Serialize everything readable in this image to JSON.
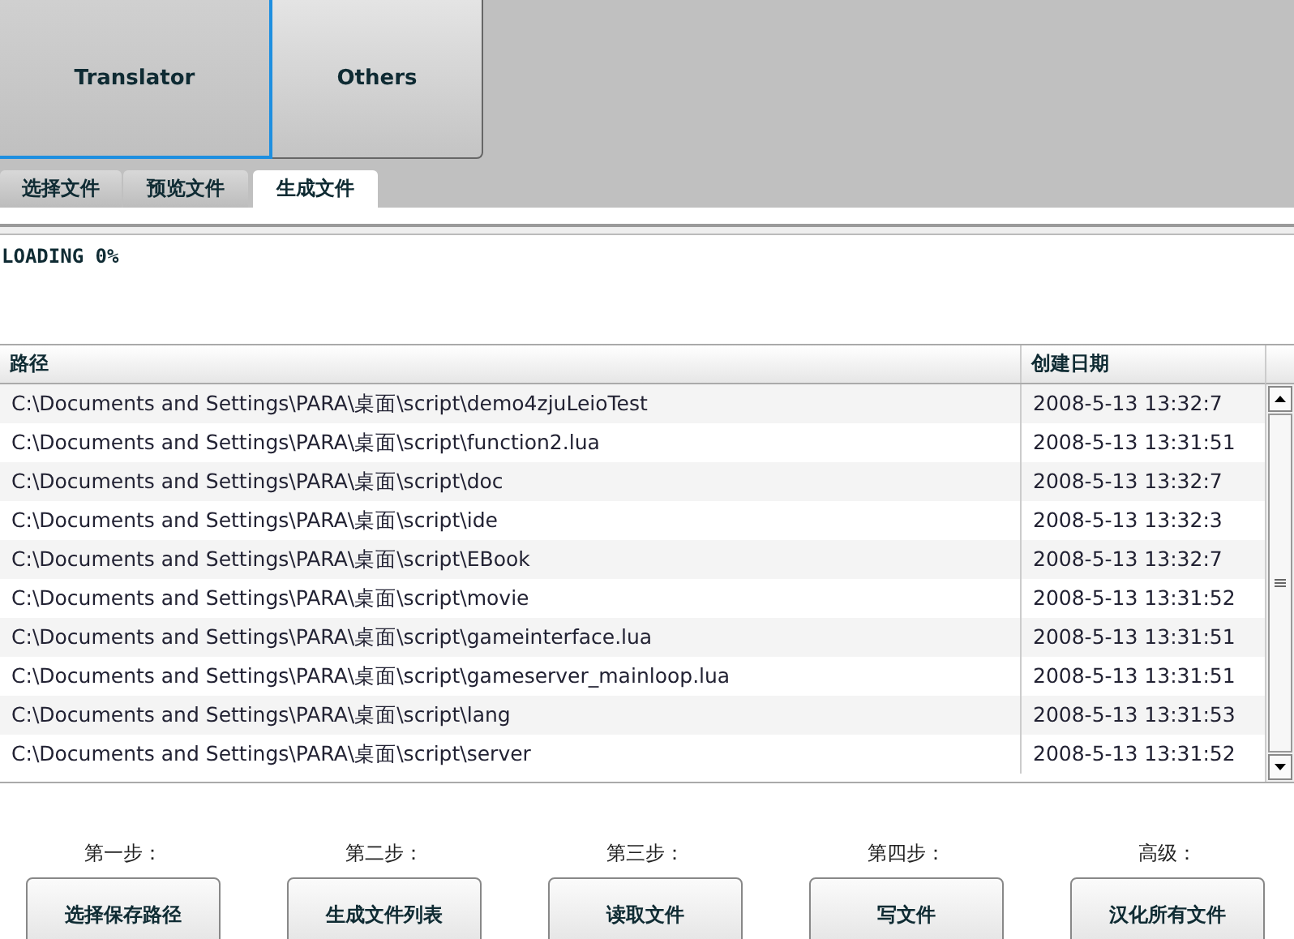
{
  "nav_buttons": [
    {
      "label": "Translator",
      "selected": true
    },
    {
      "label": "Others",
      "selected": false
    }
  ],
  "tabs": [
    {
      "label": "选择文件",
      "selected": false
    },
    {
      "label": "预览文件",
      "selected": false
    },
    {
      "label": "生成文件",
      "selected": true
    }
  ],
  "status": "LOADING 0%",
  "table": {
    "columns": [
      "路径",
      "创建日期"
    ],
    "rows": [
      [
        "C:\\Documents and Settings\\PARA\\桌面\\script\\demo4zjuLeioTest",
        "2008-5-13 13:32:7"
      ],
      [
        "C:\\Documents and Settings\\PARA\\桌面\\script\\function2.lua",
        "2008-5-13 13:31:51"
      ],
      [
        "C:\\Documents and Settings\\PARA\\桌面\\script\\doc",
        "2008-5-13 13:32:7"
      ],
      [
        "C:\\Documents and Settings\\PARA\\桌面\\script\\ide",
        "2008-5-13 13:32:3"
      ],
      [
        "C:\\Documents and Settings\\PARA\\桌面\\script\\EBook",
        "2008-5-13 13:32:7"
      ],
      [
        "C:\\Documents and Settings\\PARA\\桌面\\script\\movie",
        "2008-5-13 13:31:52"
      ],
      [
        "C:\\Documents and Settings\\PARA\\桌面\\script\\gameinterface.lua",
        "2008-5-13 13:31:51"
      ],
      [
        "C:\\Documents and Settings\\PARA\\桌面\\script\\gameserver_mainloop.lua",
        "2008-5-13 13:31:51"
      ],
      [
        "C:\\Documents and Settings\\PARA\\桌面\\script\\lang",
        "2008-5-13 13:31:53"
      ],
      [
        "C:\\Documents and Settings\\PARA\\桌面\\script\\server",
        "2008-5-13 13:31:52"
      ]
    ]
  },
  "steps": [
    {
      "label": "第一步：",
      "button": "选择保存路径"
    },
    {
      "label": "第二步：",
      "button": "生成文件列表"
    },
    {
      "label": "第三步：",
      "button": "读取文件"
    },
    {
      "label": "第四步：",
      "button": "写文件"
    },
    {
      "label": "高级：",
      "button": "汉化所有文件"
    }
  ]
}
